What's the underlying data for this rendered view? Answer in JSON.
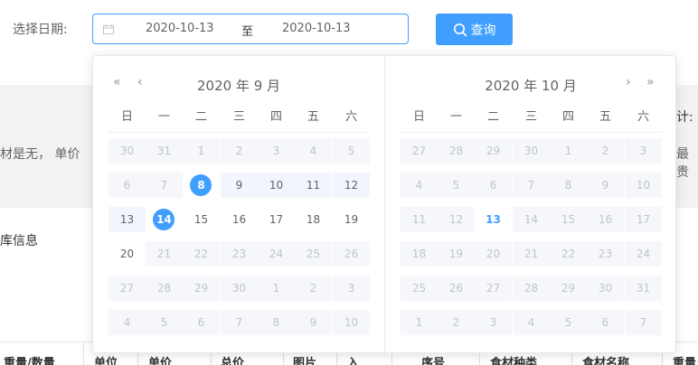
{
  "filter": {
    "date_label": "选择日期:",
    "range_separator": "至",
    "start_date": "2020-10-13",
    "end_date": "2020-10-13",
    "query_button": "查询"
  },
  "picker": {
    "weekdays": [
      "日",
      "一",
      "二",
      "三",
      "四",
      "五",
      "六"
    ],
    "left": {
      "title": "2020 年 9 月",
      "weeks": [
        [
          {
            "d": "30",
            "t": "other"
          },
          {
            "d": "31",
            "t": "other"
          },
          {
            "d": "1",
            "t": "other"
          },
          {
            "d": "2",
            "t": "other"
          },
          {
            "d": "3",
            "t": "other"
          },
          {
            "d": "4",
            "t": "other"
          },
          {
            "d": "5",
            "t": "other"
          }
        ],
        [
          {
            "d": "6",
            "t": "other"
          },
          {
            "d": "7",
            "t": "other"
          },
          {
            "d": "8",
            "t": "sel"
          },
          {
            "d": "9",
            "t": "range"
          },
          {
            "d": "10",
            "t": "range"
          },
          {
            "d": "11",
            "t": "range"
          },
          {
            "d": "12",
            "t": "range"
          }
        ],
        [
          {
            "d": "13",
            "t": "range"
          },
          {
            "d": "14",
            "t": "sel"
          },
          {
            "d": "15",
            "t": "cur"
          },
          {
            "d": "16",
            "t": "cur"
          },
          {
            "d": "17",
            "t": "cur"
          },
          {
            "d": "18",
            "t": "cur"
          },
          {
            "d": "19",
            "t": "cur"
          }
        ],
        [
          {
            "d": "20",
            "t": "cur"
          },
          {
            "d": "21",
            "t": "other"
          },
          {
            "d": "22",
            "t": "other"
          },
          {
            "d": "23",
            "t": "other"
          },
          {
            "d": "24",
            "t": "other"
          },
          {
            "d": "25",
            "t": "other"
          },
          {
            "d": "26",
            "t": "other"
          }
        ],
        [
          {
            "d": "27",
            "t": "other"
          },
          {
            "d": "28",
            "t": "other"
          },
          {
            "d": "29",
            "t": "other"
          },
          {
            "d": "30",
            "t": "other"
          },
          {
            "d": "1",
            "t": "other"
          },
          {
            "d": "2",
            "t": "other"
          },
          {
            "d": "3",
            "t": "other"
          }
        ],
        [
          {
            "d": "4",
            "t": "other"
          },
          {
            "d": "5",
            "t": "other"
          },
          {
            "d": "6",
            "t": "other"
          },
          {
            "d": "7",
            "t": "other"
          },
          {
            "d": "8",
            "t": "other"
          },
          {
            "d": "9",
            "t": "other"
          },
          {
            "d": "10",
            "t": "other"
          }
        ]
      ]
    },
    "right": {
      "title": "2020 年 10 月",
      "weeks": [
        [
          {
            "d": "27",
            "t": "other"
          },
          {
            "d": "28",
            "t": "other"
          },
          {
            "d": "29",
            "t": "other"
          },
          {
            "d": "30",
            "t": "other"
          },
          {
            "d": "1",
            "t": "other"
          },
          {
            "d": "2",
            "t": "other"
          },
          {
            "d": "3",
            "t": "other"
          }
        ],
        [
          {
            "d": "4",
            "t": "other"
          },
          {
            "d": "5",
            "t": "other"
          },
          {
            "d": "6",
            "t": "other"
          },
          {
            "d": "7",
            "t": "other"
          },
          {
            "d": "8",
            "t": "other"
          },
          {
            "d": "9",
            "t": "other"
          },
          {
            "d": "10",
            "t": "other"
          }
        ],
        [
          {
            "d": "11",
            "t": "other"
          },
          {
            "d": "12",
            "t": "other"
          },
          {
            "d": "13",
            "t": "today"
          },
          {
            "d": "14",
            "t": "other"
          },
          {
            "d": "15",
            "t": "other"
          },
          {
            "d": "16",
            "t": "other"
          },
          {
            "d": "17",
            "t": "other"
          }
        ],
        [
          {
            "d": "18",
            "t": "other"
          },
          {
            "d": "19",
            "t": "other"
          },
          {
            "d": "20",
            "t": "other"
          },
          {
            "d": "21",
            "t": "other"
          },
          {
            "d": "22",
            "t": "other"
          },
          {
            "d": "23",
            "t": "other"
          },
          {
            "d": "24",
            "t": "other"
          }
        ],
        [
          {
            "d": "25",
            "t": "other"
          },
          {
            "d": "26",
            "t": "other"
          },
          {
            "d": "27",
            "t": "other"
          },
          {
            "d": "28",
            "t": "other"
          },
          {
            "d": "29",
            "t": "other"
          },
          {
            "d": "30",
            "t": "other"
          },
          {
            "d": "31",
            "t": "other"
          }
        ],
        [
          {
            "d": "1",
            "t": "other"
          },
          {
            "d": "2",
            "t": "other"
          },
          {
            "d": "3",
            "t": "other"
          },
          {
            "d": "4",
            "t": "other"
          },
          {
            "d": "5",
            "t": "other"
          },
          {
            "d": "6",
            "t": "other"
          },
          {
            "d": "7",
            "t": "other"
          }
        ]
      ]
    }
  },
  "background": {
    "text_left": "材是无， 单价",
    "text_right_colon": "计:",
    "text_right": "最贵",
    "section": "库信息",
    "table_headers": [
      "重量/数量",
      "单位",
      "单价",
      "总价",
      "图片",
      "入",
      "序号",
      "食材种类",
      "食材名称",
      "重量"
    ]
  },
  "colors": {
    "primary": "#409eff",
    "range_bg": "#f2f6fc",
    "disabled_bg": "#f5f7fa",
    "disabled_text": "#c0c4cc"
  },
  "icons": {
    "calendar": "calendar-icon",
    "search": "search-icon",
    "prev_year": "double-chevron-left-icon",
    "prev_month": "chevron-left-icon",
    "next_month": "chevron-right-icon",
    "next_year": "double-chevron-right-icon"
  }
}
